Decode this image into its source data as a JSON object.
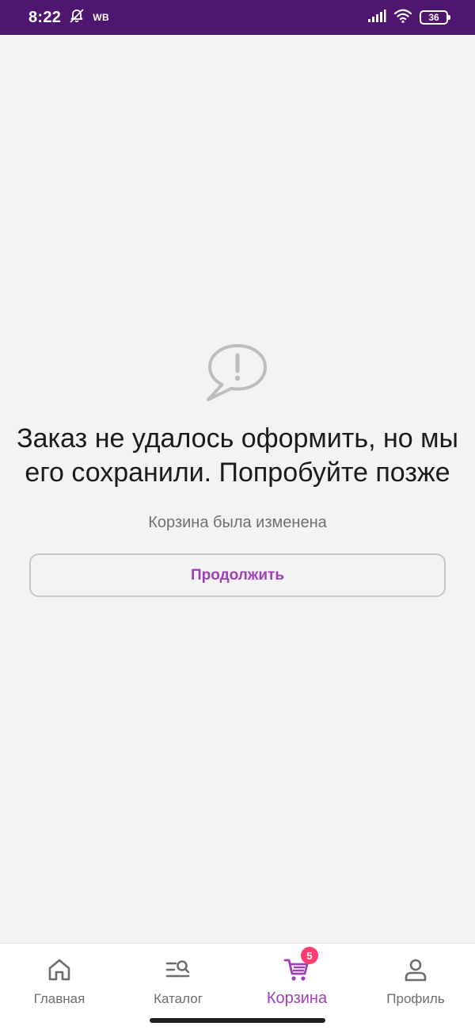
{
  "status_bar": {
    "time": "8:22",
    "carrier_label": "WB",
    "battery_level": "36",
    "icons": [
      "mute-icon",
      "signal-icon",
      "wifi-icon",
      "battery-icon"
    ]
  },
  "error": {
    "icon": "alert-speech-bubble-icon",
    "title": "Заказ не удалось оформить, но мы его сохранили. Попробуйте позже",
    "subtitle": "Корзина была изменена",
    "button_label": "Продолжить"
  },
  "bottom_nav": {
    "items": [
      {
        "label": "Главная",
        "icon": "home-icon",
        "active": false
      },
      {
        "label": "Каталог",
        "icon": "catalog-search-icon",
        "active": false
      },
      {
        "label": "Корзина",
        "icon": "cart-icon",
        "active": true,
        "badge": "5"
      },
      {
        "label": "Профиль",
        "icon": "profile-icon",
        "active": false
      }
    ]
  },
  "colors": {
    "status_bar": "#4f1670",
    "accent": "#a040b8",
    "badge": "#ff3d6e",
    "background": "#f3f3f4"
  }
}
